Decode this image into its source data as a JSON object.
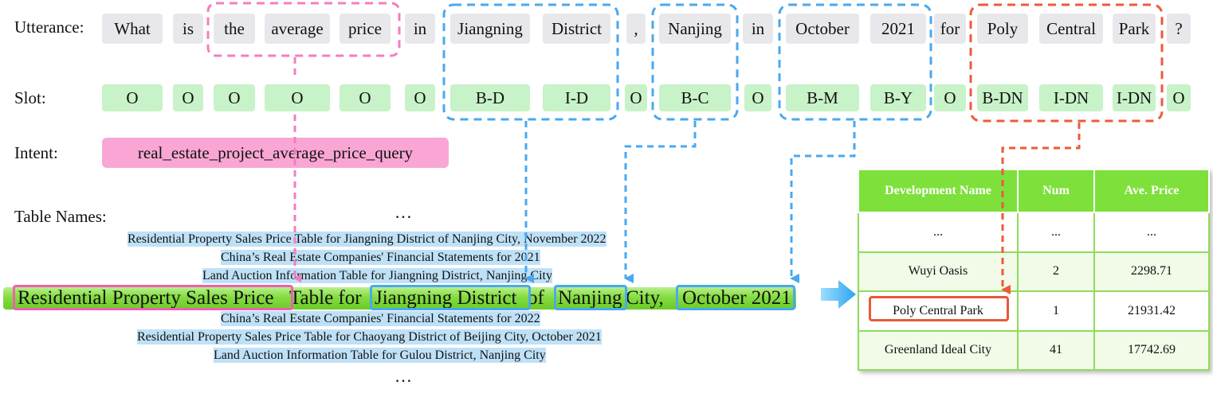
{
  "labels": {
    "utterance": "Utterance:",
    "slot": "Slot:",
    "intent": "Intent:",
    "table_names": "Table Names:"
  },
  "utterance_tokens": [
    "What",
    "is",
    "the",
    "average",
    "price",
    "in",
    "Jiangning",
    "District",
    ",",
    "Nanjing",
    "in",
    "October",
    "2021",
    "for",
    "Poly",
    "Central",
    "Park",
    "?"
  ],
  "slot_tags": [
    "O",
    "O",
    "O",
    "O",
    "O",
    "O",
    "B-D",
    "I-D",
    "O",
    "B-C",
    "O",
    "B-M",
    "B-Y",
    "O",
    "B-DN",
    "I-DN",
    "I-DN",
    "O"
  ],
  "intent_value": "real_estate_project_average_price_query",
  "ellipsis": "…",
  "table_names_above": [
    "Residential Property Sales Price Table for Jiangning District of Nanjing City, November 2022",
    "China’s Real Estate Companies' Financial Statements for 2021",
    "Land Auction Information Table for Jiangning District, Nanjing City"
  ],
  "table_names_below": [
    "China’s Real Estate Companies' Financial Statements for 2022",
    "Residential Property Sales Price Table for Chaoyang District of Beijing City, October 2021",
    "Land Auction Information Table for Gulou District, Nanjing City"
  ],
  "highlighted_table": {
    "seg1": "Residential Property Sales Price",
    "seg2": " Table for ",
    "seg3": "Jiangning District",
    "seg4": " of ",
    "seg5": "Nanjing",
    "seg6": " City, ",
    "seg7": "October 2021"
  },
  "result_table": {
    "headers": [
      "Development Name",
      "Num",
      "Ave. Price"
    ],
    "rows": [
      [
        "...",
        "...",
        "..."
      ],
      [
        "Wuyi Oasis",
        "2",
        "2298.71"
      ],
      [
        "Poly Central Park",
        "1",
        "21931.42"
      ],
      [
        "Greenland Ideal City",
        "41",
        "17742.69"
      ]
    ]
  },
  "colors": {
    "pink": "#f47dc0",
    "blue": "#4aa8ef",
    "orange": "#ee5a3a",
    "green_header": "#7ee03a"
  }
}
